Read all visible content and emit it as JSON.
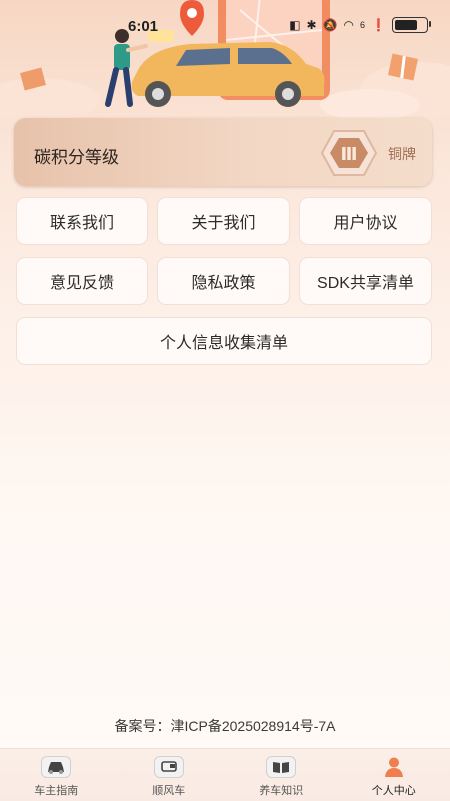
{
  "status_bar": {
    "time": "6:01",
    "signal_badge": "6",
    "battery_level": 0.8
  },
  "carbon_card": {
    "title": "碳积分等级",
    "level_label": "铜牌",
    "medal_icon": "copper-medal-icon",
    "medal_color": "#c98a66"
  },
  "menu": {
    "contact_us": "联系我们",
    "about_us": "关于我们",
    "user_agreement": "用户协议",
    "feedback": "意见反馈",
    "privacy_policy": "隐私政策",
    "sdk_list": "SDK共享清单",
    "personal_info_list": "个人信息收集清单"
  },
  "footer": {
    "record": "备案号：津ICP备2025028914号-7A"
  },
  "tabs": [
    {
      "label": "车主指南",
      "icon": "car-icon",
      "active": false
    },
    {
      "label": "顺风车",
      "icon": "van-icon",
      "active": false
    },
    {
      "label": "养车知识",
      "icon": "book-icon",
      "active": false
    },
    {
      "label": "个人中心",
      "icon": "person-icon",
      "active": true
    }
  ],
  "colors": {
    "accent": "#f07f4f",
    "car": "#f2b65c",
    "card_bg": "#f2d7c4"
  }
}
